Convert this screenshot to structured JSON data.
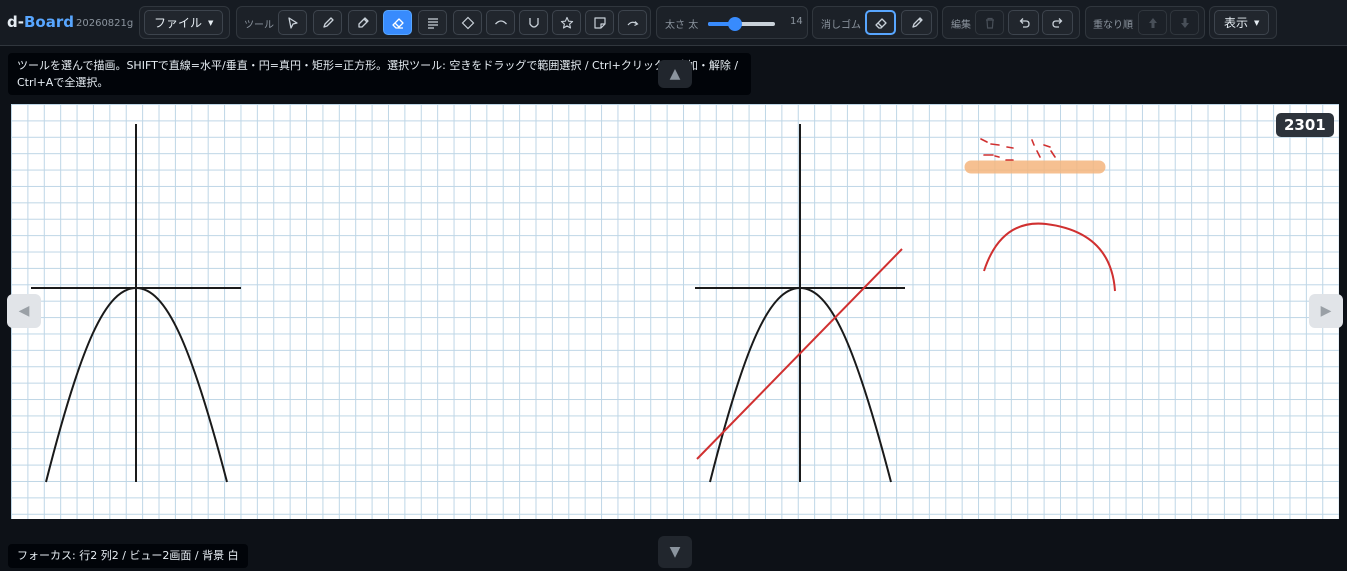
{
  "app": {
    "brand_prefix": "d-",
    "brand_name": "Board",
    "version": "20260821g"
  },
  "toolbar": {
    "file_label": "ファイル",
    "tools_label": "ツール",
    "tools": [
      {
        "name": "select-tool",
        "icon": "cursor-icon",
        "active": false
      },
      {
        "name": "pen-tool",
        "icon": "pen-icon",
        "active": false
      },
      {
        "name": "marker-tool",
        "icon": "highlighter-icon",
        "active": false
      },
      {
        "name": "eraser-tool",
        "icon": "eraser-icon",
        "active": true
      },
      {
        "name": "text-tool",
        "icon": "text-lines-icon",
        "active": false
      },
      {
        "name": "diamond-tool",
        "icon": "diamond-icon",
        "active": false
      },
      {
        "name": "arc-tool",
        "icon": "arc-icon",
        "active": false
      },
      {
        "name": "u-curve-tool",
        "icon": "u-curve-icon",
        "active": false
      },
      {
        "name": "star-tool",
        "icon": "star-icon",
        "active": false
      },
      {
        "name": "sticky-note-tool",
        "icon": "sticky-note-icon",
        "active": false
      },
      {
        "name": "arrow-tool",
        "icon": "arrow-icon",
        "active": false
      }
    ],
    "thickness_label": "太さ",
    "thickness_level": "太",
    "thickness_value": "14",
    "thickness_fraction": 0.4,
    "eraser_label": "消しゴム",
    "eraser_modes": [
      {
        "name": "stroke-eraser",
        "icon": "eraser-icon",
        "selected": true
      },
      {
        "name": "partial-eraser",
        "icon": "pencil-eraser-icon",
        "selected": false
      }
    ],
    "edit_label": "編集",
    "order_label": "重なり順",
    "view_label": "表示"
  },
  "hint_text": "ツールを選んで描画。SHIFTで直線=水平/垂直・円=真円・矩形=正方形。選択ツール: 空きをドラッグで範囲選択 / Ctrl+クリックで追加・解除 / Ctrl+Aで全選択。",
  "counter": "2301",
  "status_text": "フォーカス: 行2 列2 / ビュー2画面 / 背景 白",
  "colors": {
    "accent": "#388bfd",
    "ink": "#1a1a1a",
    "red_ink": "#d03030",
    "highlight": "#f5b67e",
    "grid": "#bed6e6"
  }
}
